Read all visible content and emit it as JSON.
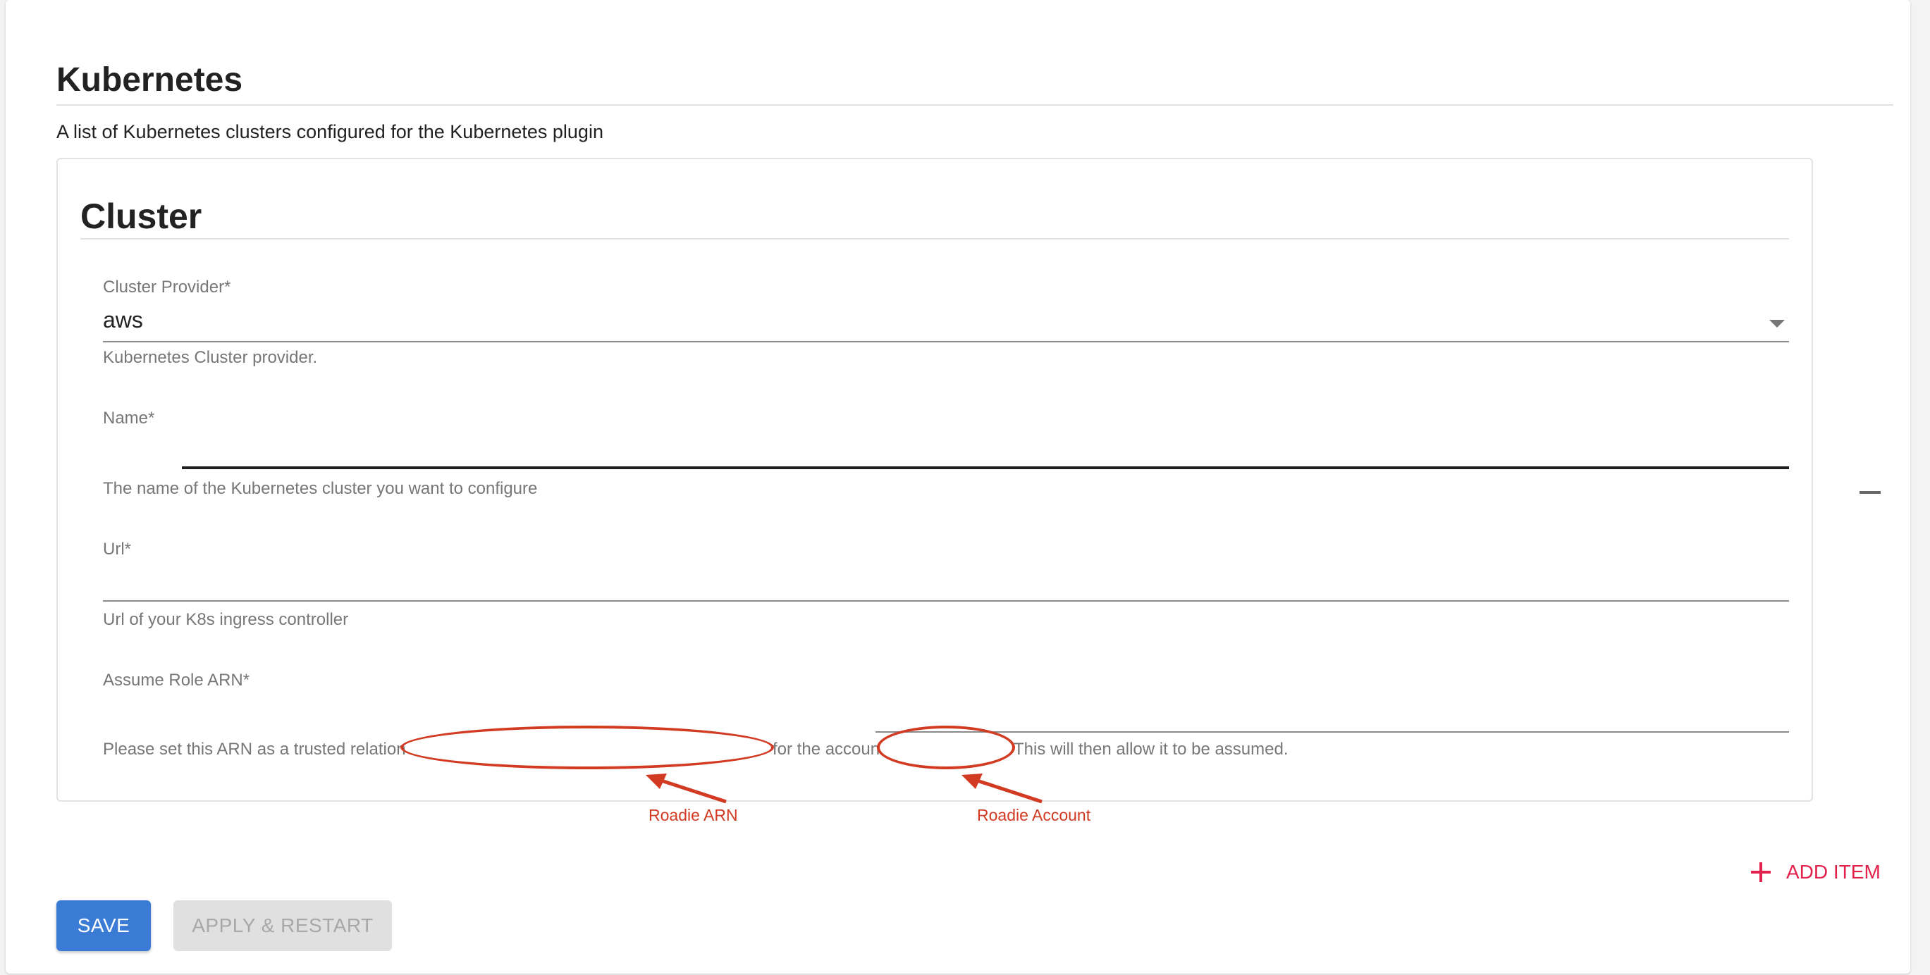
{
  "section": {
    "title": "Kubernetes",
    "description": "A list of Kubernetes clusters configured for the Kubernetes plugin"
  },
  "card": {
    "title": "Cluster",
    "cluster_provider": {
      "label": "Cluster Provider*",
      "value": "aws",
      "help": "Kubernetes Cluster provider."
    },
    "name": {
      "label": "Name*",
      "value": "",
      "help": "The name of the Kubernetes cluster you want to configure"
    },
    "url": {
      "label": "Url*",
      "value": "",
      "help": "Url of your K8s ingress controller"
    },
    "assume_role_arn": {
      "label": "Assume Role ARN*",
      "value": "",
      "help_part1": "Please set this ARN as a trusted relation",
      "help_part2": "for the accoun",
      "help_part3": "This will then allow it to be assumed."
    }
  },
  "annotations": {
    "arn_label": "Roadie ARN",
    "account_label": "Roadie Account",
    "color": "#d23a22"
  },
  "actions": {
    "add_item": "ADD ITEM",
    "save": "SAVE",
    "apply_restart": "APPLY & RESTART"
  },
  "colors": {
    "primary": "#3a7bd5",
    "accent": "#e2224c",
    "disabled_bg": "#e0e0e0"
  },
  "icons": {
    "remove": "minus-icon",
    "add": "plus-icon",
    "select": "caret-down-icon"
  }
}
